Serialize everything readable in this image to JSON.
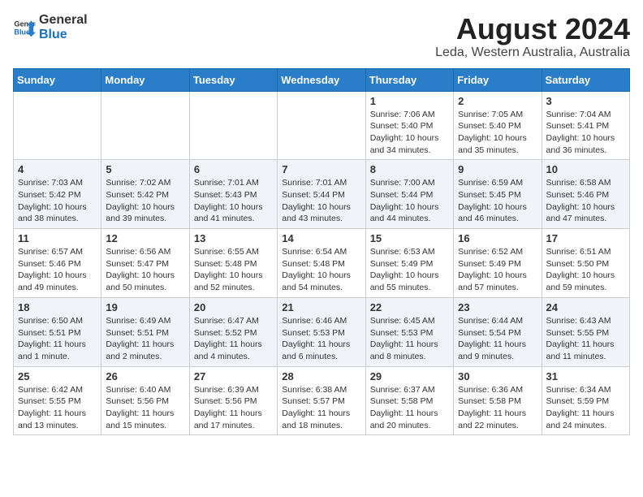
{
  "header": {
    "logo_general": "General",
    "logo_blue": "Blue",
    "month_year": "August 2024",
    "location": "Leda, Western Australia, Australia"
  },
  "days_of_week": [
    "Sunday",
    "Monday",
    "Tuesday",
    "Wednesday",
    "Thursday",
    "Friday",
    "Saturday"
  ],
  "weeks": [
    [
      {
        "day": "",
        "sunrise": "",
        "sunset": "",
        "daylight": ""
      },
      {
        "day": "",
        "sunrise": "",
        "sunset": "",
        "daylight": ""
      },
      {
        "day": "",
        "sunrise": "",
        "sunset": "",
        "daylight": ""
      },
      {
        "day": "",
        "sunrise": "",
        "sunset": "",
        "daylight": ""
      },
      {
        "day": "1",
        "sunrise": "7:06 AM",
        "sunset": "5:40 PM",
        "daylight": "10 hours and 34 minutes."
      },
      {
        "day": "2",
        "sunrise": "7:05 AM",
        "sunset": "5:40 PM",
        "daylight": "10 hours and 35 minutes."
      },
      {
        "day": "3",
        "sunrise": "7:04 AM",
        "sunset": "5:41 PM",
        "daylight": "10 hours and 36 minutes."
      }
    ],
    [
      {
        "day": "4",
        "sunrise": "7:03 AM",
        "sunset": "5:42 PM",
        "daylight": "10 hours and 38 minutes."
      },
      {
        "day": "5",
        "sunrise": "7:02 AM",
        "sunset": "5:42 PM",
        "daylight": "10 hours and 39 minutes."
      },
      {
        "day": "6",
        "sunrise": "7:01 AM",
        "sunset": "5:43 PM",
        "daylight": "10 hours and 41 minutes."
      },
      {
        "day": "7",
        "sunrise": "7:01 AM",
        "sunset": "5:44 PM",
        "daylight": "10 hours and 43 minutes."
      },
      {
        "day": "8",
        "sunrise": "7:00 AM",
        "sunset": "5:44 PM",
        "daylight": "10 hours and 44 minutes."
      },
      {
        "day": "9",
        "sunrise": "6:59 AM",
        "sunset": "5:45 PM",
        "daylight": "10 hours and 46 minutes."
      },
      {
        "day": "10",
        "sunrise": "6:58 AM",
        "sunset": "5:46 PM",
        "daylight": "10 hours and 47 minutes."
      }
    ],
    [
      {
        "day": "11",
        "sunrise": "6:57 AM",
        "sunset": "5:46 PM",
        "daylight": "10 hours and 49 minutes."
      },
      {
        "day": "12",
        "sunrise": "6:56 AM",
        "sunset": "5:47 PM",
        "daylight": "10 hours and 50 minutes."
      },
      {
        "day": "13",
        "sunrise": "6:55 AM",
        "sunset": "5:48 PM",
        "daylight": "10 hours and 52 minutes."
      },
      {
        "day": "14",
        "sunrise": "6:54 AM",
        "sunset": "5:48 PM",
        "daylight": "10 hours and 54 minutes."
      },
      {
        "day": "15",
        "sunrise": "6:53 AM",
        "sunset": "5:49 PM",
        "daylight": "10 hours and 55 minutes."
      },
      {
        "day": "16",
        "sunrise": "6:52 AM",
        "sunset": "5:49 PM",
        "daylight": "10 hours and 57 minutes."
      },
      {
        "day": "17",
        "sunrise": "6:51 AM",
        "sunset": "5:50 PM",
        "daylight": "10 hours and 59 minutes."
      }
    ],
    [
      {
        "day": "18",
        "sunrise": "6:50 AM",
        "sunset": "5:51 PM",
        "daylight": "11 hours and 1 minute."
      },
      {
        "day": "19",
        "sunrise": "6:49 AM",
        "sunset": "5:51 PM",
        "daylight": "11 hours and 2 minutes."
      },
      {
        "day": "20",
        "sunrise": "6:47 AM",
        "sunset": "5:52 PM",
        "daylight": "11 hours and 4 minutes."
      },
      {
        "day": "21",
        "sunrise": "6:46 AM",
        "sunset": "5:53 PM",
        "daylight": "11 hours and 6 minutes."
      },
      {
        "day": "22",
        "sunrise": "6:45 AM",
        "sunset": "5:53 PM",
        "daylight": "11 hours and 8 minutes."
      },
      {
        "day": "23",
        "sunrise": "6:44 AM",
        "sunset": "5:54 PM",
        "daylight": "11 hours and 9 minutes."
      },
      {
        "day": "24",
        "sunrise": "6:43 AM",
        "sunset": "5:55 PM",
        "daylight": "11 hours and 11 minutes."
      }
    ],
    [
      {
        "day": "25",
        "sunrise": "6:42 AM",
        "sunset": "5:55 PM",
        "daylight": "11 hours and 13 minutes."
      },
      {
        "day": "26",
        "sunrise": "6:40 AM",
        "sunset": "5:56 PM",
        "daylight": "11 hours and 15 minutes."
      },
      {
        "day": "27",
        "sunrise": "6:39 AM",
        "sunset": "5:56 PM",
        "daylight": "11 hours and 17 minutes."
      },
      {
        "day": "28",
        "sunrise": "6:38 AM",
        "sunset": "5:57 PM",
        "daylight": "11 hours and 18 minutes."
      },
      {
        "day": "29",
        "sunrise": "6:37 AM",
        "sunset": "5:58 PM",
        "daylight": "11 hours and 20 minutes."
      },
      {
        "day": "30",
        "sunrise": "6:36 AM",
        "sunset": "5:58 PM",
        "daylight": "11 hours and 22 minutes."
      },
      {
        "day": "31",
        "sunrise": "6:34 AM",
        "sunset": "5:59 PM",
        "daylight": "11 hours and 24 minutes."
      }
    ]
  ]
}
